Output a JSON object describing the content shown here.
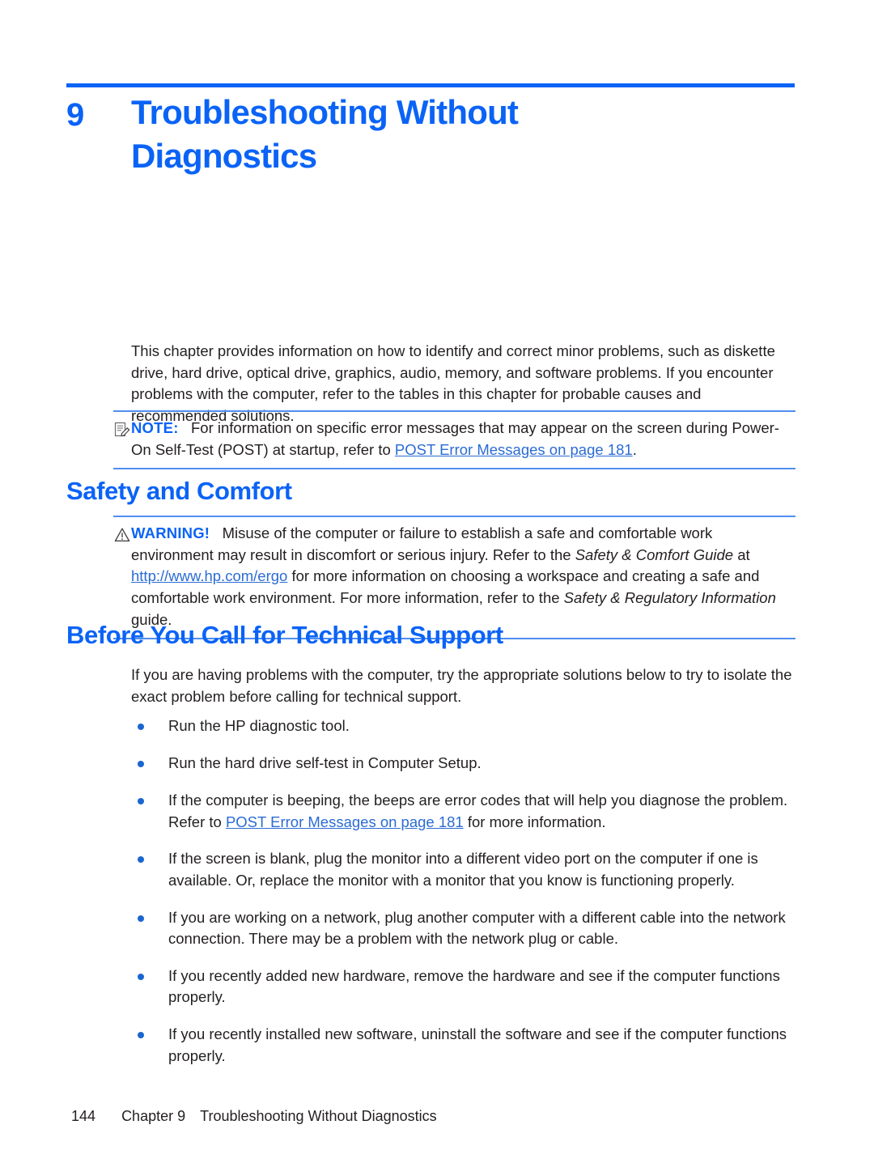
{
  "theme": {
    "accent_blue": "#0b63f6",
    "rule_blue": "#4f8ef0",
    "link_blue": "#2b6cd4",
    "bullet_blue": "#1a66d0",
    "text_black": "#231f20"
  },
  "chapter": {
    "number": "9",
    "title": "Troubleshooting Without Diagnostics"
  },
  "intro": {
    "paragraph": "This chapter provides information on how to identify and correct minor problems, such as diskette drive, hard drive, optical drive, graphics, audio, memory, and software problems. If you encounter problems with the computer, refer to the tables in this chapter for probable causes and recommended solutions."
  },
  "note": {
    "icon": "note-pencil-icon",
    "label": "NOTE:",
    "text_before_link": "For information on specific error messages that may appear on the screen during Power-On Self-Test (POST) at startup, refer to ",
    "link_text": "POST Error Messages on page 181",
    "text_after_link": "."
  },
  "sections": {
    "safety": {
      "heading": "Safety and Comfort",
      "warning": {
        "icon": "warning-triangle-icon",
        "label": "WARNING!",
        "part1": "Misuse of the computer or failure to establish a safe and comfortable work environment may result in discomfort or serious injury. Refer to the ",
        "italic1": "Safety & Comfort Guide",
        "part2": " at ",
        "link_text": "http://www.hp.com/ergo",
        "part3": " for more information on choosing a workspace and creating a safe and comfortable work environment. For more information, refer to the ",
        "italic2": "Safety & Regulatory Information",
        "part4": " guide."
      }
    },
    "before_call": {
      "heading": "Before You Call for Technical Support",
      "paragraph": "If you are having problems with the computer, try the appropriate solutions below to try to isolate the exact problem before calling for technical support.",
      "bullets": [
        {
          "text": "Run the HP diagnostic tool."
        },
        {
          "text": "Run the hard drive self-test in Computer Setup."
        },
        {
          "text_before_link": "If the computer is beeping, the beeps are error codes that will help you diagnose the problem. Refer to ",
          "link_text": "POST Error Messages on page 181",
          "text_after_link": " for more information."
        },
        {
          "text": "If the screen is blank, plug the monitor into a different video port on the computer if one is available. Or, replace the monitor with a monitor that you know is functioning properly."
        },
        {
          "text": "If you are working on a network, plug another computer with a different cable into the network connection. There may be a problem with the network plug or cable."
        },
        {
          "text": "If you recently added new hardware, remove the hardware and see if the computer functions properly."
        },
        {
          "text": "If you recently installed new software, uninstall the software and see if the computer functions properly."
        }
      ]
    }
  },
  "footer": {
    "page_number": "144",
    "chapter_label": "Chapter 9",
    "chapter_title": "Troubleshooting Without Diagnostics"
  }
}
